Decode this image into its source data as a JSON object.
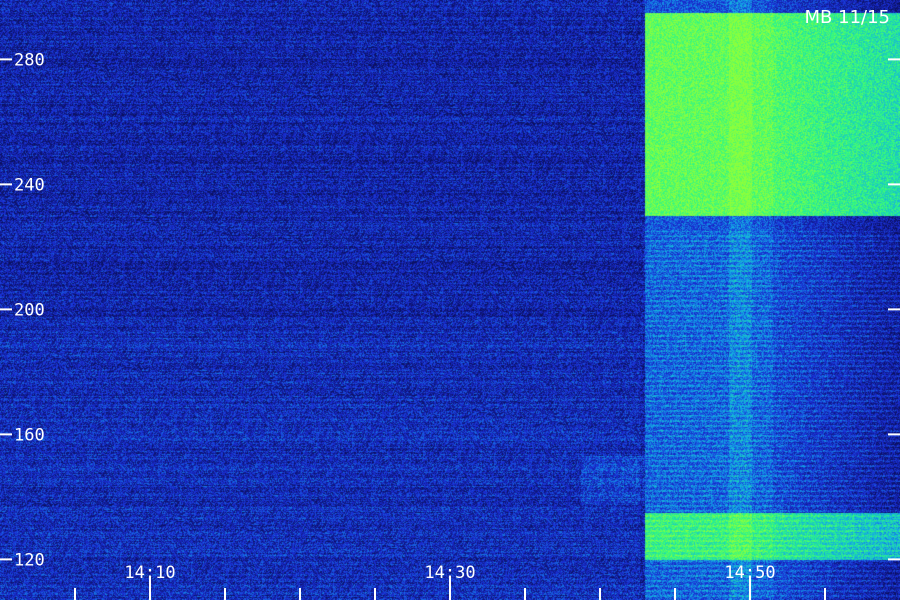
{
  "chart_data": {
    "type": "heatmap",
    "title": "",
    "station_label": "MB 11/15",
    "xlabel": "",
    "ylabel": "",
    "x_ticks": [
      "14:10",
      "14:30",
      "14:50"
    ],
    "x_tick_minutes": [
      10,
      30,
      50
    ],
    "x_minor_tick_minutes": [
      5,
      10,
      15,
      20,
      25,
      30,
      35,
      40,
      45,
      50,
      55
    ],
    "xlim_minutes": [
      0,
      60
    ],
    "y_ticks": [
      120,
      160,
      200,
      240,
      280
    ],
    "ylim": [
      107,
      299
    ],
    "colormap": [
      "#0a0f5c",
      "#1a2ed6",
      "#12a8e8",
      "#2af58a",
      "#8cff3c"
    ],
    "burst": {
      "start_minute": 43,
      "end_minute": 60,
      "peak_bands": [
        {
          "y_range": [
            230,
            295
          ],
          "intensity": 0.85
        },
        {
          "y_range": [
            120,
            135
          ],
          "intensity": 0.7
        }
      ]
    }
  }
}
